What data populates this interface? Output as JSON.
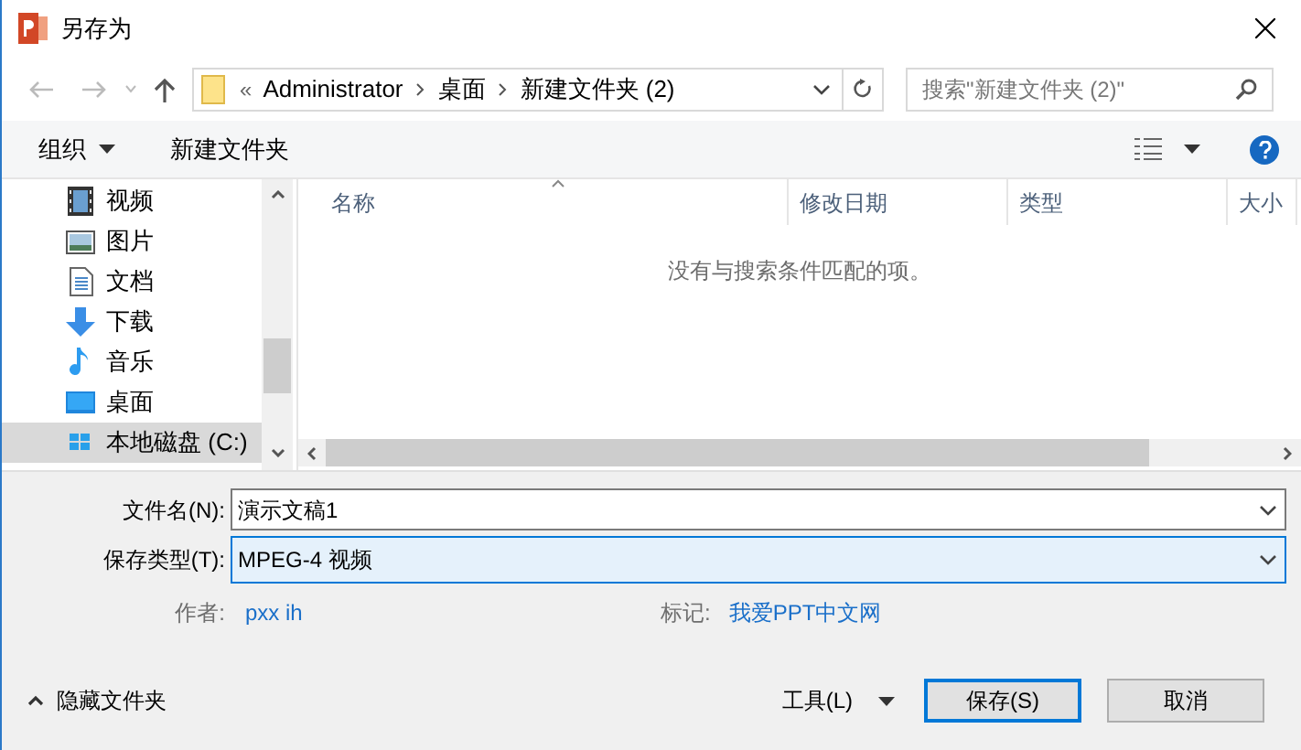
{
  "window": {
    "title": "另存为"
  },
  "address": {
    "overflow": "«",
    "segments": [
      "Administrator",
      "桌面",
      "新建文件夹 (2)"
    ]
  },
  "search": {
    "placeholder": "搜索\"新建文件夹 (2)\""
  },
  "toolbar": {
    "organize": "组织",
    "new_folder": "新建文件夹"
  },
  "sidebar": {
    "items": [
      {
        "label": "视频",
        "kind": "video",
        "selected": false
      },
      {
        "label": "图片",
        "kind": "pictures",
        "selected": false
      },
      {
        "label": "文档",
        "kind": "documents",
        "selected": false
      },
      {
        "label": "下载",
        "kind": "downloads",
        "selected": false
      },
      {
        "label": "音乐",
        "kind": "music",
        "selected": false
      },
      {
        "label": "桌面",
        "kind": "desktop",
        "selected": false
      },
      {
        "label": "本地磁盘 (C:)",
        "kind": "drive",
        "selected": true
      }
    ]
  },
  "table": {
    "columns": [
      "名称",
      "修改日期",
      "类型",
      "大小"
    ],
    "empty_message": "没有与搜索条件匹配的项。"
  },
  "form": {
    "filename_label": "文件名(N):",
    "filename": "演示文稿1",
    "type_label": "保存类型(T):",
    "type": "MPEG-4 视频",
    "author_label": "作者:",
    "author": "pxx ih",
    "tags_label": "标记:",
    "tags": "我爱PPT中文网"
  },
  "footer": {
    "hide_folders": "隐藏文件夹",
    "tools": "工具(L)",
    "save": "保存(S)",
    "cancel": "取消"
  }
}
